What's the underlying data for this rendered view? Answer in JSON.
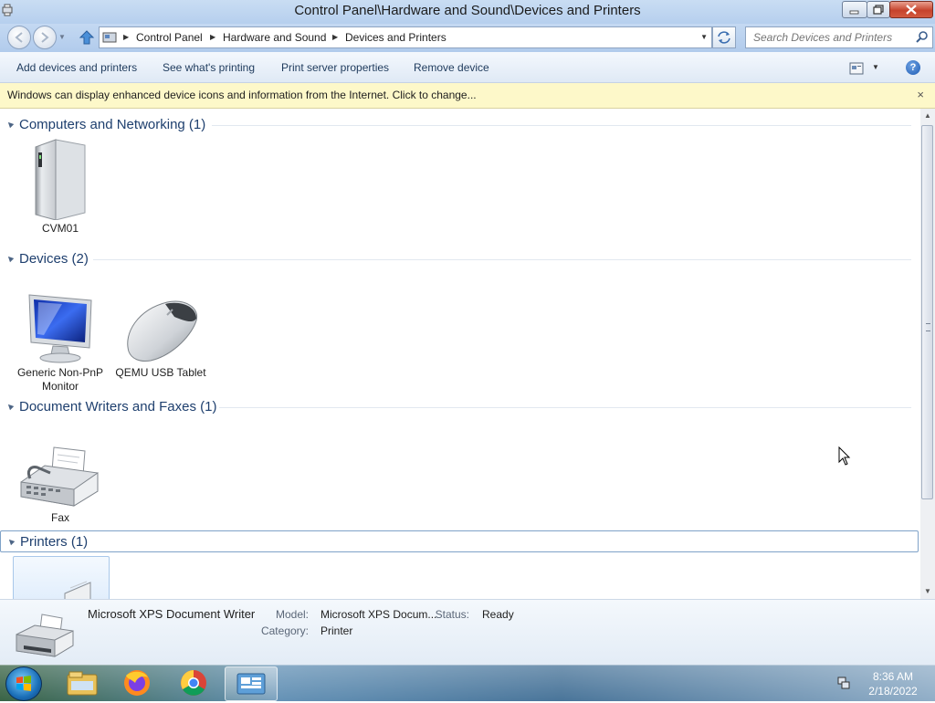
{
  "window": {
    "title": "Control Panel\\Hardware and Sound\\Devices and Printers"
  },
  "address": {
    "crumbs": [
      "Control Panel",
      "Hardware and Sound",
      "Devices and Printers"
    ],
    "search_placeholder": "Search Devices and Printers"
  },
  "commands": {
    "add": "Add devices and printers",
    "see_printing": "See what's printing",
    "print_server": "Print server properties",
    "remove": "Remove device"
  },
  "infobar": {
    "text": "Windows can display enhanced device icons and information from the Internet. Click to change...",
    "close": "×"
  },
  "groups": [
    {
      "label": "Computers and Networking (1)",
      "devices": [
        {
          "name": "CVM01",
          "icon": "computer-tower-icon"
        }
      ]
    },
    {
      "label": "Devices (2)",
      "devices": [
        {
          "name": "Generic Non-PnP Monitor",
          "icon": "monitor-icon"
        },
        {
          "name": "QEMU USB Tablet",
          "icon": "mouse-icon"
        }
      ]
    },
    {
      "label": "Document Writers and Faxes (1)",
      "devices": [
        {
          "name": "Fax",
          "icon": "fax-icon"
        }
      ]
    },
    {
      "label": "Printers (1)",
      "devices": [
        {
          "name": "",
          "icon": "printer-icon"
        }
      ]
    }
  ],
  "details": {
    "name": "Microsoft XPS Document Writer",
    "model_label": "Model:",
    "model_value": "Microsoft XPS Docum...",
    "status_label": "Status:",
    "status_value": "Ready",
    "category_label": "Category:",
    "category_value": "Printer"
  },
  "taskbar": {
    "apps": [
      "start-orb-icon",
      "file-explorer-icon",
      "firefox-icon",
      "chrome-icon",
      "devices-and-printers-icon"
    ],
    "time": "8:36 AM",
    "date": "2/18/2022"
  },
  "colors": {
    "group_header": "#1e3f6e",
    "infobar_bg": "#fdf8c9",
    "command_text": "#1e3a5c"
  }
}
